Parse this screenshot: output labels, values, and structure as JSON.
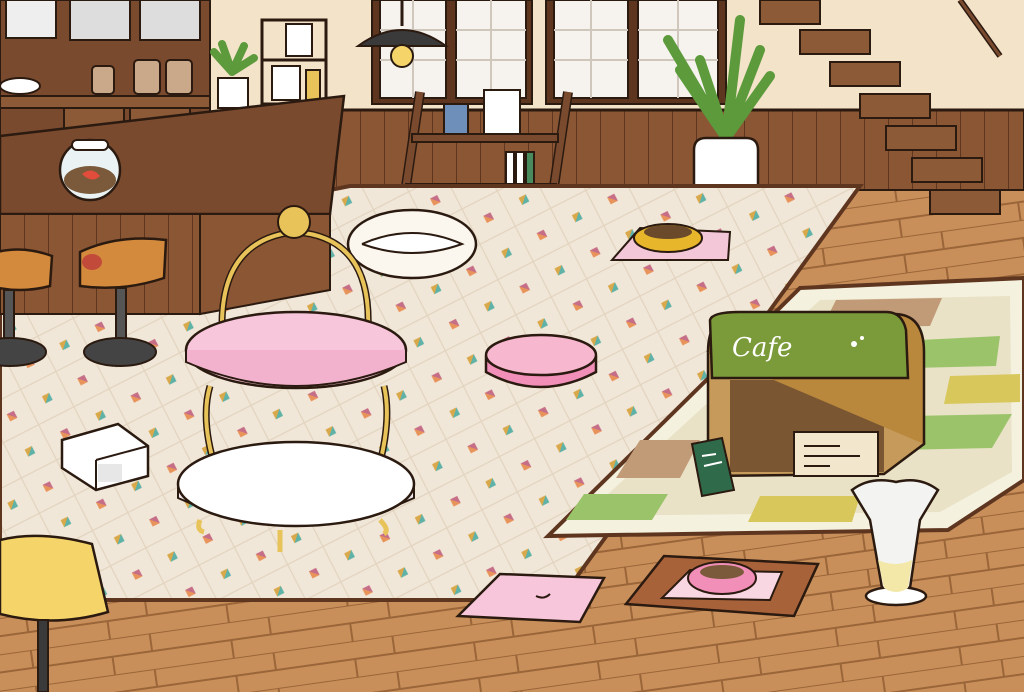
{
  "scene": {
    "colors": {
      "wall": "#f3e3c9",
      "floor_wood": "#c98f5a",
      "floor_wood_dark": "#a8703f",
      "tile_rug": "#f1e7d8",
      "counter": "#7a4a2e",
      "outline": "#2b1a10",
      "pink": "#f2a9c7",
      "gold": "#e8c35a",
      "green_awning": "#7b9a3a"
    },
    "cafe_box": {
      "sign_text": "Cafe"
    },
    "items": [
      {
        "name": "goldfish-bowl"
      },
      {
        "name": "bar-stool-1"
      },
      {
        "name": "bar-stool-2"
      },
      {
        "name": "two-tier-cake-stand"
      },
      {
        "name": "cushion-bed-white"
      },
      {
        "name": "pink-round-cushion"
      },
      {
        "name": "food-bowl-top"
      },
      {
        "name": "food-bowl-bottom"
      },
      {
        "name": "cafe-cardboard-box"
      },
      {
        "name": "glass-vase"
      },
      {
        "name": "pink-cushion-small"
      },
      {
        "name": "paper-bag-toy"
      },
      {
        "name": "floor-lamp"
      },
      {
        "name": "potted-plant"
      },
      {
        "name": "wooden-staircase"
      }
    ]
  }
}
